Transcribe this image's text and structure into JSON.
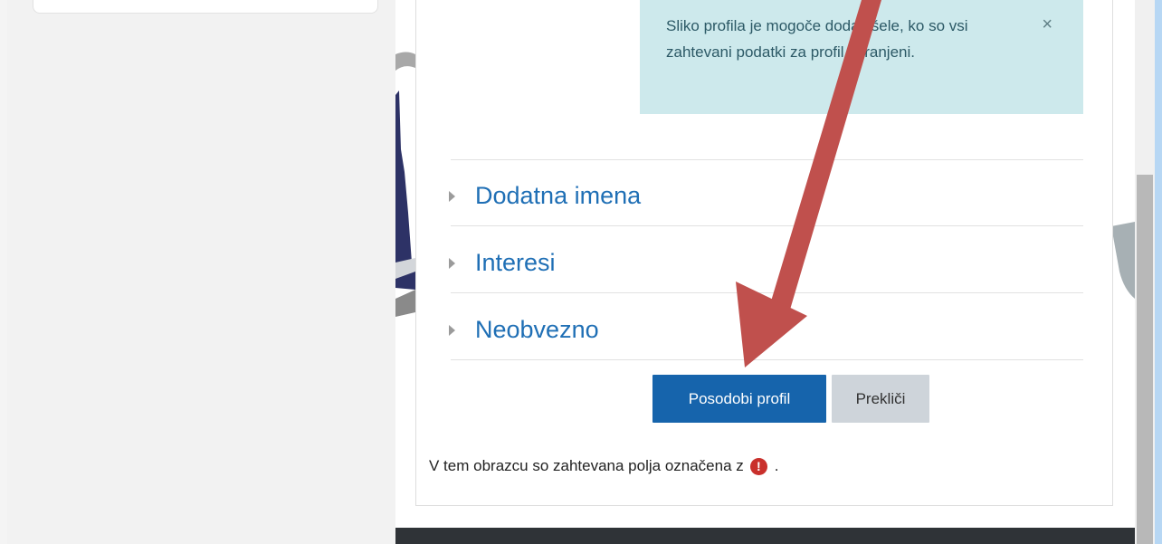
{
  "alert": {
    "message": "Sliko profila je mogoče dodati šele, ko so vsi zahtevani podatki za profil shranjeni.",
    "close_glyph": "×"
  },
  "sections": [
    {
      "label": "Dodatna imena"
    },
    {
      "label": "Interesi"
    },
    {
      "label": "Neobvezno"
    }
  ],
  "actions": {
    "submit_label": "Posodobi profil",
    "cancel_label": "Prekliči"
  },
  "required_note": {
    "text": "V tem obrazcu so zahtevana polja označena z",
    "icon_glyph": "!",
    "suffix": "."
  },
  "colors": {
    "primary": "#1664ac",
    "link": "#1f6fb5",
    "alert_bg": "#cde9ec",
    "required_icon": "#c9302c",
    "annotation_arrow": "#c0504d"
  },
  "icons": {
    "close": "close-icon",
    "section_toggle": "caret-right-icon",
    "required": "exclamation-circle-icon"
  }
}
